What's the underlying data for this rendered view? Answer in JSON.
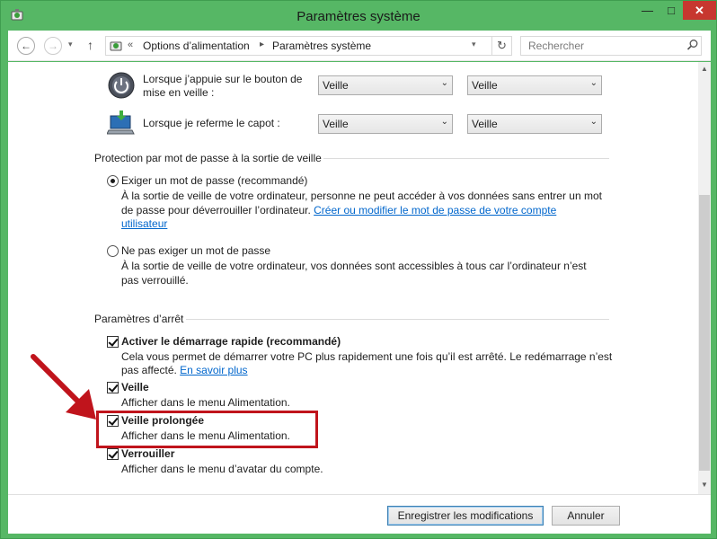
{
  "window": {
    "title": "Paramètres système",
    "controls": {
      "minimize": "—",
      "maximize": "□",
      "close": "✕"
    }
  },
  "navigation": {
    "back": "←",
    "forward": "→",
    "recent": "▾",
    "up": "↑",
    "breadcrumb_chevron": "«",
    "breadcrumbs": [
      "Options d’alimentation",
      "Paramètres système"
    ],
    "breadcrumb_separator": "▸",
    "address_dropdown": "▾",
    "refresh": "↻",
    "search_placeholder": "Rechercher"
  },
  "power_buttons": {
    "rows": [
      {
        "icon": "power-button-icon",
        "label": "Lorsque j’appuie sur le bouton de mise en veille :",
        "battery_value": "Veille",
        "plugged_value": "Veille"
      },
      {
        "icon": "laptop-lid-icon",
        "label": "Lorsque je referme le capot :",
        "battery_value": "Veille",
        "plugged_value": "Veille"
      }
    ],
    "dropdown_arrow": "⌄"
  },
  "password_section": {
    "title": "Protection par mot de passe à la sortie de veille",
    "options": [
      {
        "label": "Exiger un mot de passe (recommandé)",
        "checked": true,
        "desc_line1": "À la sortie de veille de votre ordinateur, personne ne peut accéder à vos données sans entrer un mot",
        "desc_line2": "de passe pour déverrouiller l’ordinateur.",
        "link": "Créer ou modifier le mot de passe de votre compte",
        "link_cont": "utilisateur"
      },
      {
        "label": "Ne pas exiger un mot de passe",
        "checked": false,
        "desc_line1": "À la sortie de veille de votre ordinateur, vos données sont accessibles à tous car l’ordinateur n’est",
        "desc_line2": "pas verrouillé."
      }
    ]
  },
  "shutdown_section": {
    "title": "Paramètres d’arrêt",
    "options": [
      {
        "label": "Activer le démarrage rapide (recommandé)",
        "checked": true,
        "desc_line1": "Cela vous permet de démarrer votre PC plus rapidement une fois qu’il est arrêté. Le redémarrage n’est",
        "desc_line2": "pas affecté.",
        "link": "En savoir plus"
      },
      {
        "label": "Veille",
        "checked": true,
        "desc": "Afficher dans le menu Alimentation."
      },
      {
        "label": "Veille prolongée",
        "checked": true,
        "desc": "Afficher dans le menu Alimentation.",
        "highlighted": true
      },
      {
        "label": "Verrouiller",
        "checked": true,
        "desc": "Afficher dans le menu d’avatar du compte."
      }
    ]
  },
  "footer": {
    "save": "Enregistrer les modifications",
    "cancel": "Annuler"
  },
  "scrollbar": {
    "up": "▲",
    "down": "▼"
  },
  "colors": {
    "window_frame": "#56b765",
    "close_button": "#c7372f",
    "annotation": "#c0141c",
    "link": "#0066cc"
  }
}
